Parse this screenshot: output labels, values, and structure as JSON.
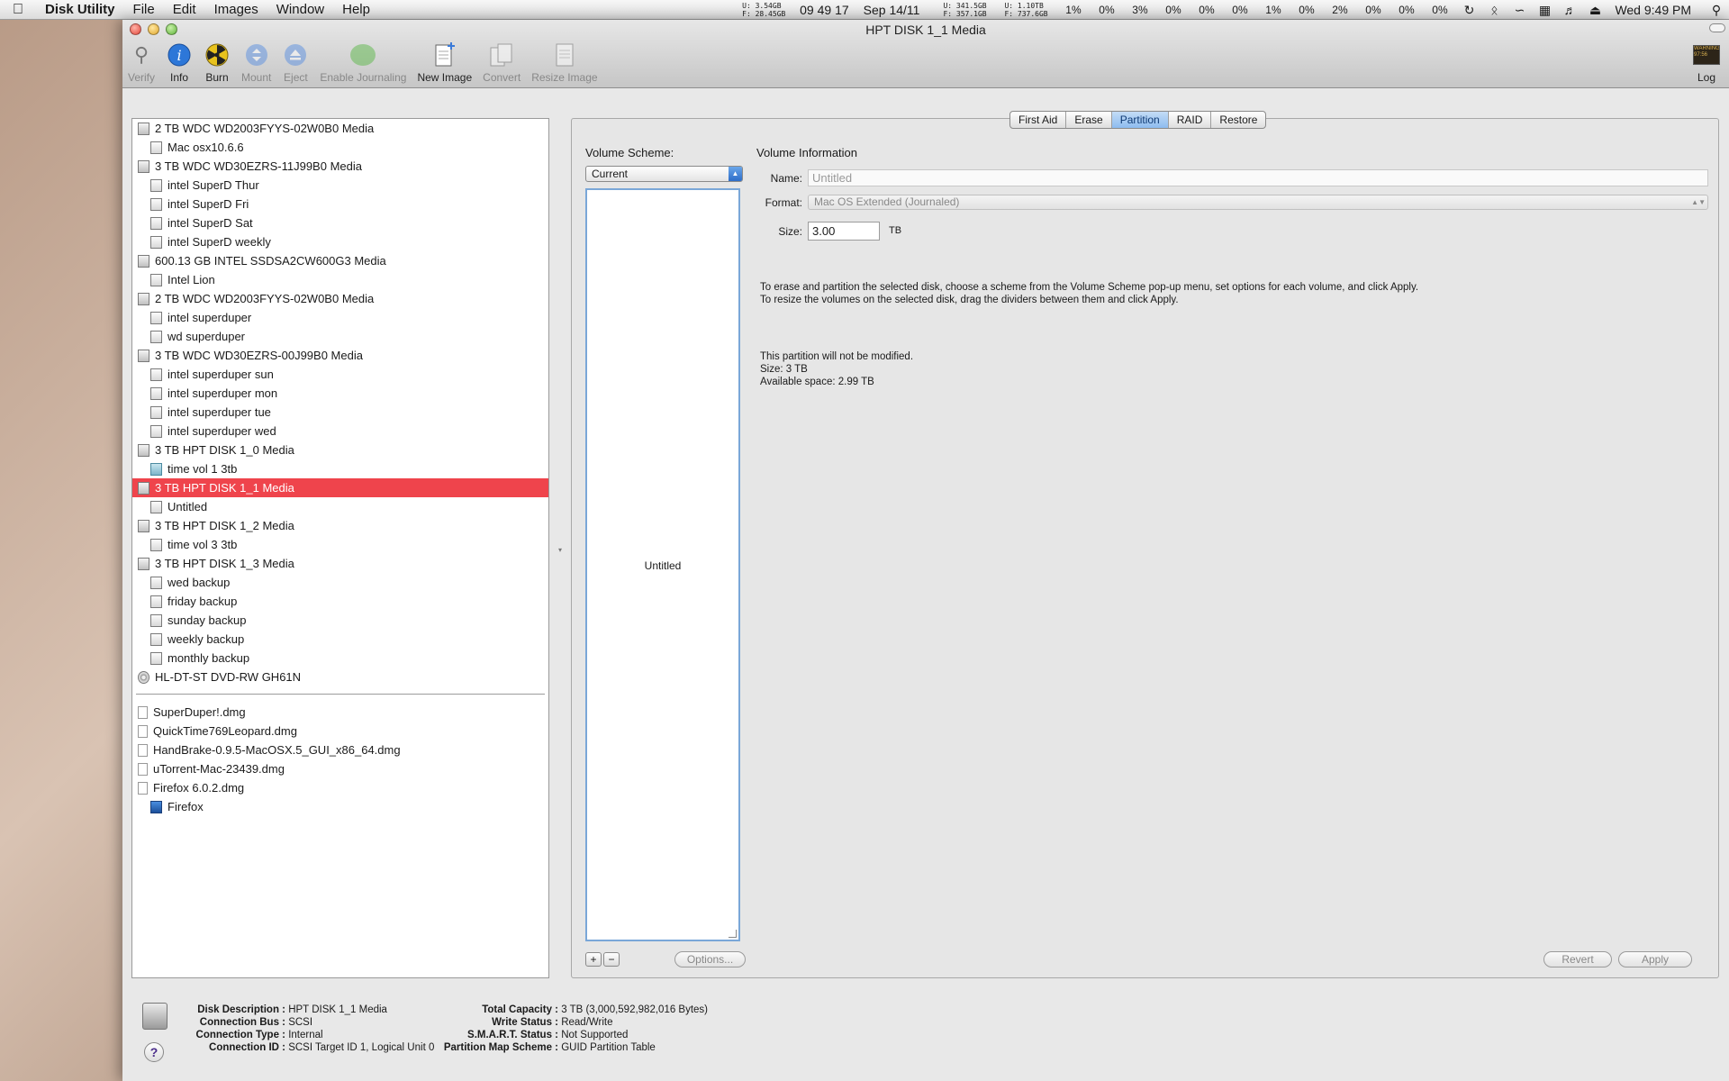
{
  "menubar": {
    "app_name": "Disk Utility",
    "menus": [
      "File",
      "Edit",
      "Images",
      "Window",
      "Help"
    ],
    "mem_stats": {
      "u1": "U:",
      "u1v": "3.54GB",
      "f1": "F:",
      "f1v": "28.45GB"
    },
    "time_counter": "09 49 17",
    "date": "Sep 14/11",
    "disk_stats": {
      "u1": "U: 341.5GB",
      "f1": "F: 357.1GB",
      "u2": "U: 1.10TB",
      "f2": "F: 737.6GB"
    },
    "cpu": [
      "1%",
      "0%",
      "3%",
      "0%",
      "0%",
      "0%",
      "1%",
      "0%",
      "2%",
      "0%",
      "0%",
      "0%"
    ],
    "clock": "Wed 9:49 PM"
  },
  "window": {
    "title": "HPT DISK 1_1 Media",
    "toolbar": [
      {
        "label": "Verify",
        "icon": "microscope-icon",
        "enabled": false
      },
      {
        "label": "Info",
        "icon": "info-icon",
        "enabled": true
      },
      {
        "label": "Burn",
        "icon": "burn-icon",
        "enabled": true
      },
      {
        "label": "Mount",
        "icon": "mount-icon",
        "enabled": false
      },
      {
        "label": "Eject",
        "icon": "eject-icon",
        "enabled": false
      },
      {
        "label": "Enable Journaling",
        "icon": "journaling-icon",
        "enabled": false
      },
      {
        "label": "New Image",
        "icon": "new-image-icon",
        "enabled": true
      },
      {
        "label": "Convert",
        "icon": "convert-icon",
        "enabled": false
      },
      {
        "label": "Resize Image",
        "icon": "resize-image-icon",
        "enabled": false
      }
    ],
    "log_label": "Log",
    "log_icon_text": "WARNING\n97:56"
  },
  "sidebar": {
    "devices": [
      {
        "kind": "disk",
        "label": "2 TB WDC WD2003FYYS-02W0B0 Media"
      },
      {
        "kind": "vol",
        "label": "Mac  osx10.6.6"
      },
      {
        "kind": "disk",
        "label": "3 TB WDC WD30EZRS-11J99B0 Media"
      },
      {
        "kind": "vol",
        "label": "intel SuperD Thur"
      },
      {
        "kind": "vol",
        "label": "intel SuperD Fri"
      },
      {
        "kind": "vol",
        "label": "intel SuperD Sat"
      },
      {
        "kind": "vol",
        "label": "intel SuperD weekly"
      },
      {
        "kind": "disk",
        "label": "600.13 GB INTEL SSDSA2CW600G3 Media"
      },
      {
        "kind": "vol",
        "label": "Intel Lion"
      },
      {
        "kind": "disk",
        "label": "2 TB WDC WD2003FYYS-02W0B0 Media"
      },
      {
        "kind": "vol",
        "label": "intel superduper"
      },
      {
        "kind": "vol",
        "label": "wd superduper"
      },
      {
        "kind": "disk",
        "label": "3 TB WDC WD30EZRS-00J99B0 Media"
      },
      {
        "kind": "vol",
        "label": "intel superduper sun"
      },
      {
        "kind": "vol",
        "label": "intel superduper mon"
      },
      {
        "kind": "vol",
        "label": "intel superduper tue"
      },
      {
        "kind": "vol",
        "label": "intel superduper wed"
      },
      {
        "kind": "disk",
        "label": "3 TB HPT DISK 1_0 Media"
      },
      {
        "kind": "vol",
        "label": "time vol 1 3tb",
        "icon": "time-machine"
      },
      {
        "kind": "disk",
        "label": "3 TB HPT DISK 1_1 Media",
        "selected": true
      },
      {
        "kind": "vol",
        "label": "Untitled"
      },
      {
        "kind": "disk",
        "label": "3 TB HPT DISK 1_2 Media"
      },
      {
        "kind": "vol",
        "label": "time vol 3 3tb"
      },
      {
        "kind": "disk",
        "label": "3 TB HPT DISK 1_3 Media"
      },
      {
        "kind": "vol",
        "label": "wed backup"
      },
      {
        "kind": "vol",
        "label": "friday backup"
      },
      {
        "kind": "vol",
        "label": "sunday backup"
      },
      {
        "kind": "vol",
        "label": "weekly backup"
      },
      {
        "kind": "vol",
        "label": "monthly backup"
      },
      {
        "kind": "disk",
        "label": "HL-DT-ST DVD-RW GH61N",
        "icon": "optical"
      }
    ],
    "images": [
      {
        "kind": "disk",
        "label": "SuperDuper!.dmg",
        "icon": "dmg"
      },
      {
        "kind": "disk",
        "label": "QuickTime769Leopard.dmg",
        "icon": "dmg"
      },
      {
        "kind": "disk",
        "label": "HandBrake-0.9.5-MacOSX.5_GUI_x86_64.dmg",
        "icon": "dmg"
      },
      {
        "kind": "disk",
        "label": "uTorrent-Mac-23439.dmg",
        "icon": "dmg"
      },
      {
        "kind": "disk",
        "label": "Firefox 6.0.2.dmg",
        "icon": "dmg"
      },
      {
        "kind": "vol",
        "label": "Firefox",
        "icon": "app"
      }
    ]
  },
  "tabs": [
    {
      "label": "First Aid",
      "active": false
    },
    {
      "label": "Erase",
      "active": false
    },
    {
      "label": "Partition",
      "active": true
    },
    {
      "label": "RAID",
      "active": false
    },
    {
      "label": "Restore",
      "active": false
    }
  ],
  "partition": {
    "volume_scheme_label": "Volume Scheme:",
    "volume_scheme_value": "Current",
    "map_volume_label": "Untitled",
    "add_label": "+",
    "remove_label": "−",
    "options_label": "Options...",
    "volume_info_title": "Volume Information",
    "name_label": "Name:",
    "name_value": "Untitled",
    "format_label": "Format:",
    "format_value": "Mac OS Extended (Journaled)",
    "size_label": "Size:",
    "size_value": "3.00",
    "size_unit": "TB",
    "instructions_1": "To erase and partition the selected disk, choose a scheme from the Volume Scheme pop-up menu, set options for each volume, and click Apply.",
    "instructions_2": "To resize the volumes on the selected disk, drag the dividers between them and click Apply.",
    "status_1": "This partition will not be modified.",
    "status_2": "Size: 3 TB",
    "status_3": "Available space: 2.99 TB",
    "revert_label": "Revert",
    "apply_label": "Apply"
  },
  "disk_info": {
    "left": [
      {
        "k": "Disk Description :",
        "v": "HPT DISK 1_1 Media"
      },
      {
        "k": "Connection Bus :",
        "v": "SCSI"
      },
      {
        "k": "Connection Type :",
        "v": "Internal"
      },
      {
        "k": "Connection ID :",
        "v": "SCSI Target ID 1, Logical Unit 0"
      }
    ],
    "right": [
      {
        "k": "Total Capacity :",
        "v": "3 TB (3,000,592,982,016 Bytes)"
      },
      {
        "k": "Write Status :",
        "v": "Read/Write"
      },
      {
        "k": "S.M.A.R.T. Status :",
        "v": "Not Supported"
      },
      {
        "k": "Partition Map Scheme :",
        "v": "GUID Partition Table"
      }
    ],
    "help_label": "?"
  }
}
